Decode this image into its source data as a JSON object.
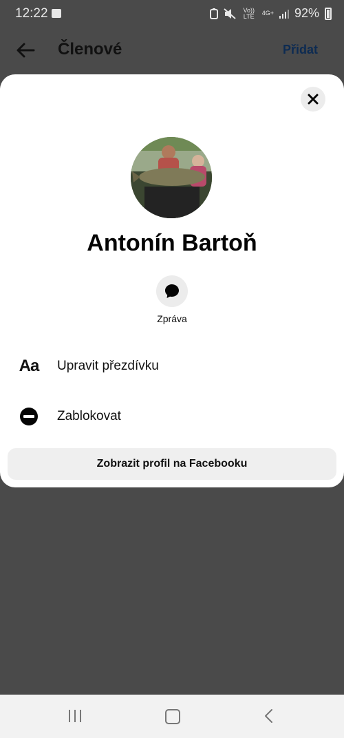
{
  "status_bar": {
    "time": "12:22",
    "volte": "Vo)) LTE",
    "network": "4G+",
    "battery": "92%"
  },
  "header": {
    "title": "Členové",
    "add_label": "Přidat"
  },
  "profile": {
    "name": "Antonín Bartoň",
    "message_label": "Zpráva"
  },
  "actions": [
    {
      "label": "Upravit přezdívku",
      "icon_text": "Aa",
      "icon": "text-aa-icon"
    },
    {
      "label": "Zablokovat",
      "icon": "block-icon"
    }
  ],
  "facebook_button": "Zobrazit profil na Facebooku",
  "colors": {
    "overlay": "#4a4a4a",
    "sheet": "#ffffff",
    "link_blue": "#0d2b52",
    "button_gray": "#efefef"
  }
}
